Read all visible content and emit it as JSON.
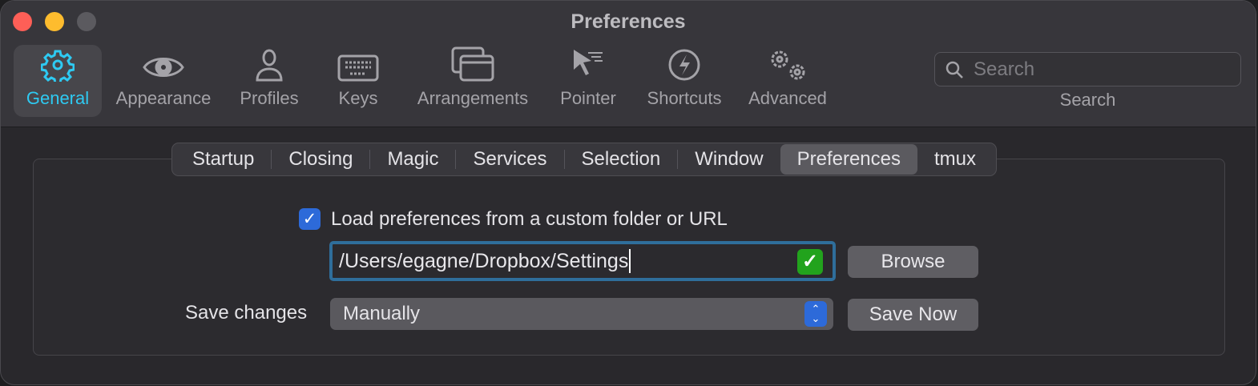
{
  "window": {
    "title": "Preferences"
  },
  "toolbar": {
    "items": [
      {
        "label": "General",
        "icon": "gear-icon"
      },
      {
        "label": "Appearance",
        "icon": "eye-icon"
      },
      {
        "label": "Profiles",
        "icon": "person-icon"
      },
      {
        "label": "Keys",
        "icon": "keyboard-icon"
      },
      {
        "label": "Arrangements",
        "icon": "windows-icon"
      },
      {
        "label": "Pointer",
        "icon": "pointer-icon"
      },
      {
        "label": "Shortcuts",
        "icon": "bolt-icon"
      },
      {
        "label": "Advanced",
        "icon": "gears-icon"
      }
    ],
    "search_placeholder": "Search",
    "search_label": "Search"
  },
  "tabs": [
    "Startup",
    "Closing",
    "Magic",
    "Services",
    "Selection",
    "Window",
    "Preferences",
    "tmux"
  ],
  "selected_tab": "Preferences",
  "prefs": {
    "load_checkbox_label": "Load preferences from a custom folder or URL",
    "load_checked": true,
    "path_value": "/Users/egagne/Dropbox/Settings",
    "browse_label": "Browse",
    "save_changes_label": "Save changes",
    "save_changes_value": "Manually",
    "save_now_label": "Save Now"
  },
  "colors": {
    "accent": "#2ecaf2",
    "checkbox": "#2d6ad9",
    "focus_ring": "#2f6e9b"
  }
}
